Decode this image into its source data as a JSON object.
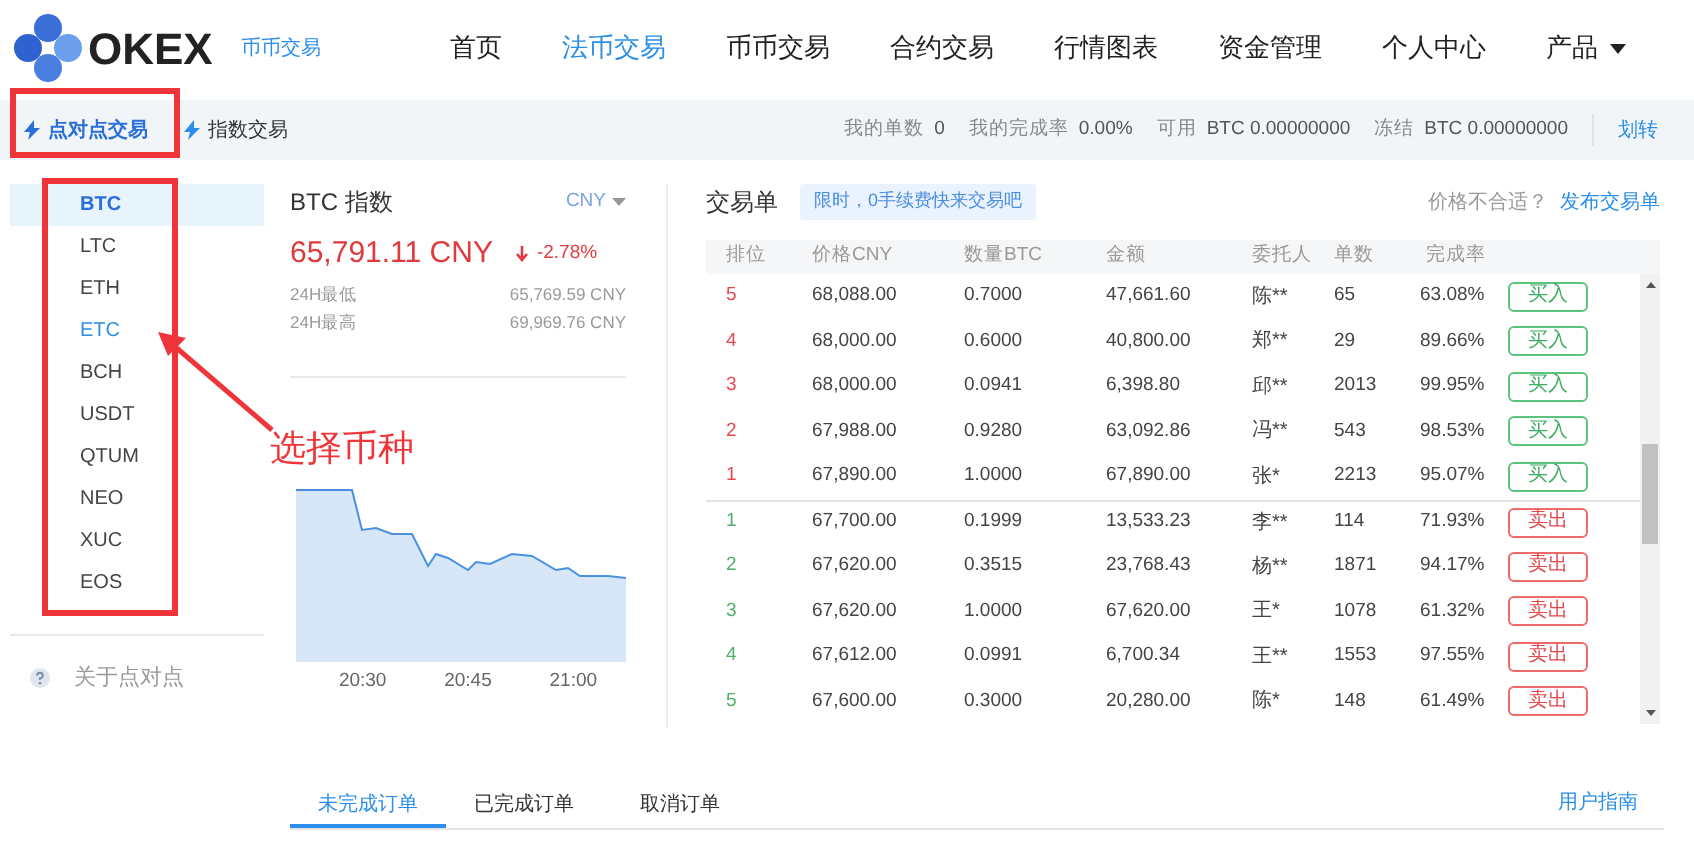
{
  "header": {
    "logo": "OKEX",
    "subtitle": "币币交易",
    "nav": [
      {
        "label": "首页",
        "selected": false
      },
      {
        "label": "法币交易",
        "selected": true
      },
      {
        "label": "币币交易",
        "selected": false
      },
      {
        "label": "合约交易",
        "selected": false
      },
      {
        "label": "行情图表",
        "selected": false
      },
      {
        "label": "资金管理",
        "selected": false
      },
      {
        "label": "个人中心",
        "selected": false
      },
      {
        "label": "产品",
        "selected": false,
        "dropdown": true
      }
    ]
  },
  "subbar": {
    "tabs": [
      {
        "label": "点对点交易",
        "selected": true
      },
      {
        "label": "指数交易",
        "selected": false
      }
    ],
    "stats": [
      {
        "label": "我的单数",
        "value": "0"
      },
      {
        "label": "我的完成率",
        "value": "0.00%"
      },
      {
        "label": "可用",
        "value": "BTC 0.00000000"
      },
      {
        "label": "冻结",
        "value": "BTC 0.00000000"
      }
    ],
    "transfer": "划转"
  },
  "sidebar": {
    "coins": [
      {
        "label": "BTC",
        "selected": true,
        "hover": false
      },
      {
        "label": "LTC",
        "selected": false,
        "hover": false
      },
      {
        "label": "ETH",
        "selected": false,
        "hover": false
      },
      {
        "label": "ETC",
        "selected": false,
        "hover": true
      },
      {
        "label": "BCH",
        "selected": false,
        "hover": false
      },
      {
        "label": "USDT",
        "selected": false,
        "hover": false
      },
      {
        "label": "QTUM",
        "selected": false,
        "hover": false
      },
      {
        "label": "NEO",
        "selected": false,
        "hover": false
      },
      {
        "label": "XUC",
        "selected": false,
        "hover": false
      },
      {
        "label": "EOS",
        "selected": false,
        "hover": false
      }
    ],
    "help": "关于点对点"
  },
  "index": {
    "title": "BTC 指数",
    "currency": "CNY",
    "price": "65,791.11 CNY",
    "change": "-2.78%",
    "stats": [
      {
        "label": "24H最低",
        "value": "65,769.59 CNY"
      },
      {
        "label": "24H最高",
        "value": "69,969.76 CNY"
      }
    ],
    "time_labels": [
      "20:30",
      "20:45",
      "21:00"
    ]
  },
  "orders": {
    "title": "交易单",
    "promo": "限时，0手续费快来交易吧",
    "hint": "价格不合适？",
    "publish": "发布交易单",
    "columns": [
      "排位",
      "价格CNY",
      "数量BTC",
      "金额",
      "委托人",
      "单数",
      "完成率"
    ],
    "rows": [
      {
        "kind": "buy",
        "rank": "5",
        "price": "68,088.00",
        "qty": "0.7000",
        "amount": "47,661.60",
        "person": "陈**",
        "count": "65",
        "rate": "63.08%",
        "action": "买入"
      },
      {
        "kind": "buy",
        "rank": "4",
        "price": "68,000.00",
        "qty": "0.6000",
        "amount": "40,800.00",
        "person": "郑**",
        "count": "29",
        "rate": "89.66%",
        "action": "买入"
      },
      {
        "kind": "buy",
        "rank": "3",
        "price": "68,000.00",
        "qty": "0.0941",
        "amount": "6,398.80",
        "person": "邱**",
        "count": "2013",
        "rate": "99.95%",
        "action": "买入"
      },
      {
        "kind": "buy",
        "rank": "2",
        "price": "67,988.00",
        "qty": "0.9280",
        "amount": "63,092.86",
        "person": "冯**",
        "count": "543",
        "rate": "98.53%",
        "action": "买入"
      },
      {
        "kind": "buy",
        "rank": "1",
        "price": "67,890.00",
        "qty": "1.0000",
        "amount": "67,890.00",
        "person": "张*",
        "count": "2213",
        "rate": "95.07%",
        "action": "买入"
      },
      {
        "kind": "sell",
        "rank": "1",
        "price": "67,700.00",
        "qty": "0.1999",
        "amount": "13,533.23",
        "person": "李**",
        "count": "114",
        "rate": "71.93%",
        "action": "卖出"
      },
      {
        "kind": "sell",
        "rank": "2",
        "price": "67,620.00",
        "qty": "0.3515",
        "amount": "23,768.43",
        "person": "杨**",
        "count": "1871",
        "rate": "94.17%",
        "action": "卖出"
      },
      {
        "kind": "sell",
        "rank": "3",
        "price": "67,620.00",
        "qty": "1.0000",
        "amount": "67,620.00",
        "person": "王*",
        "count": "1078",
        "rate": "61.32%",
        "action": "卖出"
      },
      {
        "kind": "sell",
        "rank": "4",
        "price": "67,612.00",
        "qty": "0.0991",
        "amount": "6,700.34",
        "person": "王**",
        "count": "1553",
        "rate": "97.55%",
        "action": "卖出"
      },
      {
        "kind": "sell",
        "rank": "5",
        "price": "67,600.00",
        "qty": "0.3000",
        "amount": "20,280.00",
        "person": "陈*",
        "count": "148",
        "rate": "61.49%",
        "action": "卖出"
      }
    ]
  },
  "bottom_tabs": {
    "tabs": [
      {
        "label": "未完成订单",
        "selected": true
      },
      {
        "label": "已完成订单",
        "selected": false
      },
      {
        "label": "取消订单",
        "selected": false
      }
    ],
    "guide": "用户指南"
  },
  "annotation": {
    "callout": "选择币种"
  }
}
